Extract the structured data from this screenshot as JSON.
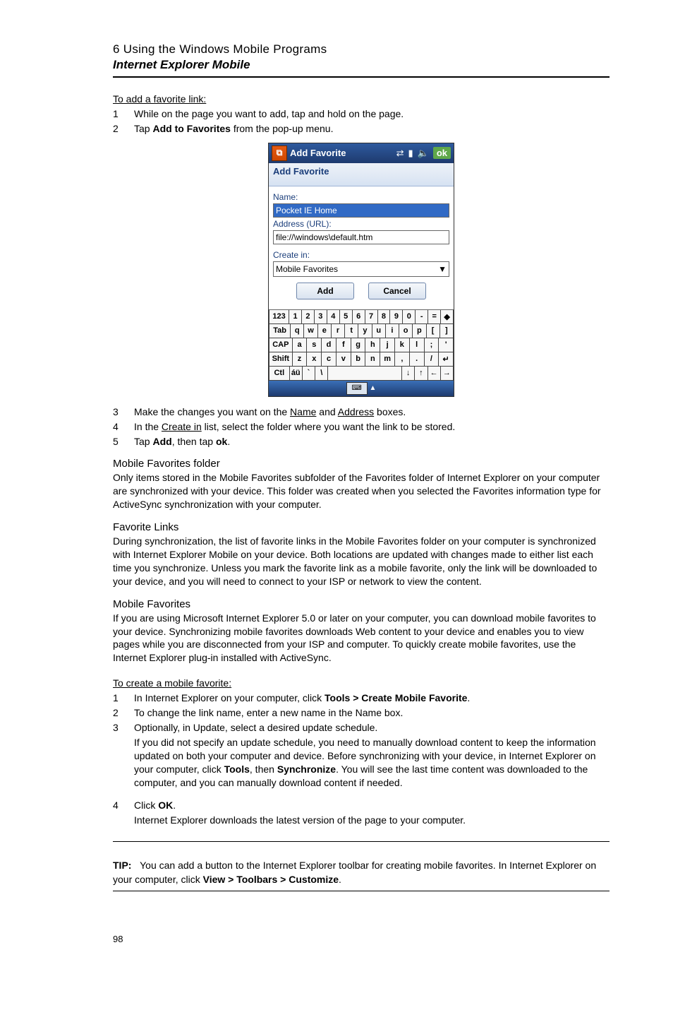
{
  "header": {
    "chapter": "6 Using the Windows Mobile Programs",
    "title": "Internet Explorer Mobile"
  },
  "addFavorite": {
    "heading": "To add a favorite link:",
    "steps": [
      {
        "n": "1",
        "t_pre": "While on the page you want to add, tap and hold on the page."
      },
      {
        "n": "2",
        "t_pre": "Tap ",
        "bold": "Add to Favorites",
        "t_post": " from the pop-up menu."
      }
    ]
  },
  "screenshot": {
    "titlebar": "Add Favorite",
    "ok": "ok",
    "subheader": "Add Favorite",
    "name_label": "Name:",
    "name_value": "Pocket IE Home",
    "addr_label": "Address (URL):",
    "addr_value": "file://\\windows\\default.htm",
    "createin_label": "Create in:",
    "createin_value": "Mobile Favorites",
    "btn_add": "Add",
    "btn_cancel": "Cancel",
    "rows": {
      "r1": [
        "123",
        "1",
        "2",
        "3",
        "4",
        "5",
        "6",
        "7",
        "8",
        "9",
        "0",
        "-",
        "=",
        "◆"
      ],
      "r2": [
        "Tab",
        "q",
        "w",
        "e",
        "r",
        "t",
        "y",
        "u",
        "i",
        "o",
        "p",
        "[",
        "]"
      ],
      "r3": [
        "CAP",
        "a",
        "s",
        "d",
        "f",
        "g",
        "h",
        "j",
        "k",
        "l",
        ";",
        "'"
      ],
      "r4": [
        "Shift",
        "z",
        "x",
        "c",
        "v",
        "b",
        "n",
        "m",
        ",",
        ".",
        "/",
        "↵"
      ],
      "r5": [
        "Ctl",
        "áü",
        "`",
        "\\",
        " ",
        "↓",
        "↑",
        "←",
        "→"
      ]
    }
  },
  "afterShot": {
    "steps": [
      {
        "n": "3",
        "parts": [
          "Make the changes you want on the ",
          {
            "u": "Name"
          },
          " and ",
          {
            "u": "Address"
          },
          " boxes."
        ]
      },
      {
        "n": "4",
        "parts": [
          "In the ",
          {
            "u": "Create in"
          },
          " list, select the folder where you want the link to be stored."
        ]
      },
      {
        "n": "5",
        "parts": [
          "Tap ",
          {
            "b": "Add"
          },
          ", then tap ",
          {
            "b": "ok"
          },
          "."
        ]
      }
    ]
  },
  "mff": {
    "title": "Mobile Favorites folder",
    "para": "Only items stored in the Mobile Favorites subfolder of the Favorites folder of Internet Explorer on your computer are synchronized with your device. This folder was created when you selected the Favorites information type for ActiveSync synchronization with your computer."
  },
  "fl": {
    "title": "Favorite Links",
    "para": "During synchronization, the list of favorite links in the Mobile Favorites folder on your computer is synchronized with Internet Explorer Mobile on your device. Both locations are updated with changes made to either list each time you synchronize. Unless you mark the favorite link as a mobile favorite, only the link will be downloaded to your device, and you will need to connect to your ISP or network to view the content."
  },
  "mf": {
    "title": "Mobile Favorites",
    "para": "If you are using Microsoft Internet Explorer 5.0 or later on your computer, you can download mobile favorites to your device. Synchronizing mobile favorites downloads Web content to your device and enables you to view pages while you are disconnected from your ISP and computer. To quickly create mobile favorites, use the Internet Explorer plug-in installed with ActiveSync."
  },
  "createMobile": {
    "heading": "To create a mobile favorite:",
    "steps": [
      {
        "n": "1",
        "parts": [
          "In Internet Explorer on your computer, click ",
          {
            "b": "Tools > Create Mobile Favorite"
          },
          "."
        ]
      },
      {
        "n": "2",
        "parts": [
          "To change the link name, enter a new name in the Name box."
        ]
      },
      {
        "n": "3",
        "parts": [
          "Optionally, in Update, select a desired update schedule."
        ]
      }
    ],
    "step3_sub": [
      "If you did not specify an update schedule, you need to manually download content to keep the information updated on both your computer and device. Before synchronizing with your device, in Internet Explorer on your computer, click ",
      {
        "b": "Tools"
      },
      ", then ",
      {
        "b": "Synchronize"
      },
      ". You will see the last time content was downloaded to the computer, and you can manually download content if needed."
    ],
    "step4": {
      "n": "4",
      "parts": [
        "Click ",
        {
          "b": "OK"
        },
        "."
      ]
    },
    "step4_sub": "Internet Explorer downloads the latest version of the page to your computer."
  },
  "tip": {
    "label": "TIP:",
    "parts": [
      "You can add a button to the Internet Explorer toolbar for creating mobile favorites. In Internet Explorer on your computer, click ",
      {
        "b": "View > Toolbars > Customize"
      },
      "."
    ]
  },
  "pagenum": "98"
}
